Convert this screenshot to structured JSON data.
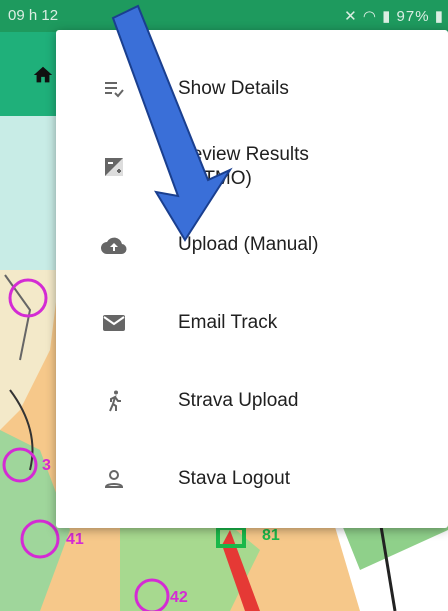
{
  "status": {
    "time": "09 h 12",
    "battery": "97%"
  },
  "menu": {
    "items": [
      {
        "icon": "checklist-icon",
        "label": "Show Details"
      },
      {
        "icon": "exposure-icon",
        "label_line1": "Review Results",
        "label_line2": "(HITMO)"
      },
      {
        "icon": "cloud-upload-icon",
        "label": "Upload (Manual)"
      },
      {
        "icon": "mail-icon",
        "label": "Email Track"
      },
      {
        "icon": "runner-icon",
        "label": "Strava Upload"
      },
      {
        "icon": "person-icon",
        "label": "Stava Logout"
      }
    ]
  },
  "map": {
    "controls": [
      "3",
      "41",
      "81",
      "42"
    ]
  },
  "colors": {
    "statusbar": "#1e9a5e",
    "appbar": "#1fb07a",
    "arrow": "#3a6fd8",
    "control": "#d42bd4"
  }
}
